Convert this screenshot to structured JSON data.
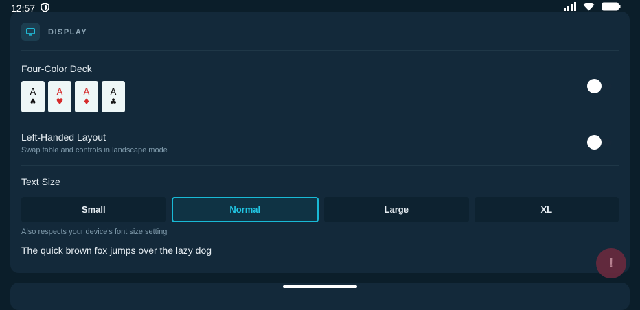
{
  "status_bar": {
    "time": "12:57",
    "left_icons": [
      "shield-icon"
    ],
    "right_icons": [
      "signal-icon",
      "wifi-icon",
      "battery-icon"
    ]
  },
  "display_section": {
    "icon": "monitor-icon",
    "title": "DISPLAY",
    "four_color_deck": {
      "label": "Four-Color Deck",
      "enabled": false,
      "cards": [
        {
          "rank": "A",
          "suit": "♠",
          "color": "#111111"
        },
        {
          "rank": "A",
          "suit": "♥",
          "color": "#d62b2b"
        },
        {
          "rank": "A",
          "suit": "♦",
          "color": "#d62b2b"
        },
        {
          "rank": "A",
          "suit": "♣",
          "color": "#111111"
        }
      ]
    },
    "left_handed": {
      "label": "Left-Handed Layout",
      "subtitle": "Swap table and controls in landscape mode",
      "enabled": false
    },
    "text_size": {
      "label": "Text Size",
      "options": [
        "Small",
        "Normal",
        "Large",
        "XL"
      ],
      "selected": "Normal",
      "note": "Also respects your device's font size setting",
      "sample": "The quick brown fox jumps over the lazy dog"
    }
  },
  "fab": {
    "label": "!",
    "icon": "alert-icon"
  },
  "colors": {
    "background": "#0b1e2a",
    "card": "#13293a",
    "accent": "#19b9d5",
    "muted_text": "#7f9aab"
  }
}
